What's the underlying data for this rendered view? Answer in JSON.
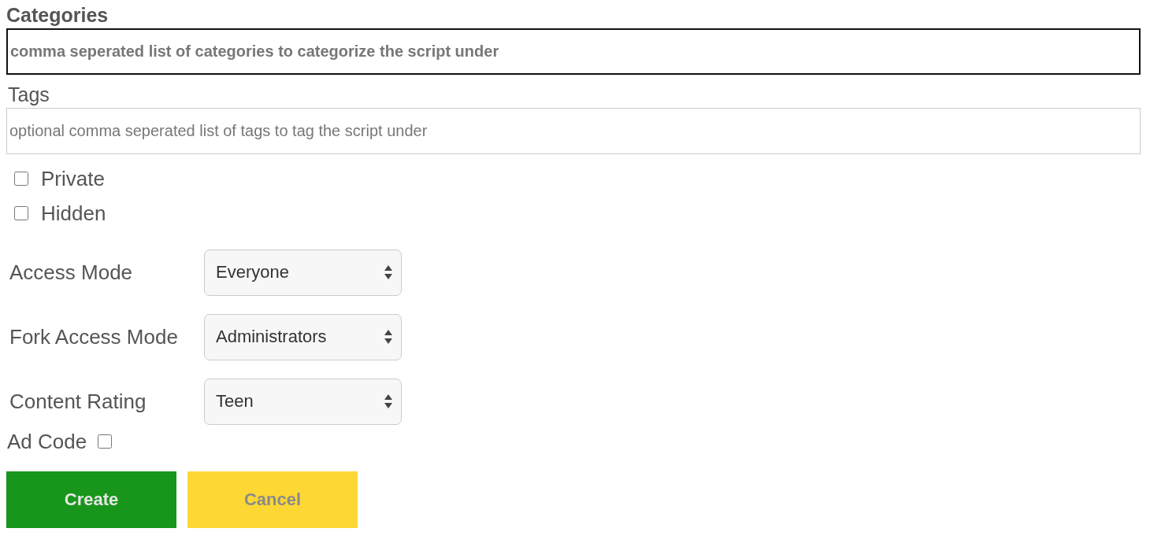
{
  "categories": {
    "label": "Categories",
    "placeholder": "comma seperated list of categories to categorize the script under",
    "focused": true
  },
  "tags": {
    "label": "Tags",
    "placeholder": "optional comma seperated list of tags to tag the script under",
    "focused": false
  },
  "checkboxes": [
    {
      "label": "Private",
      "checked": false
    },
    {
      "label": "Hidden",
      "checked": false
    }
  ],
  "selects": [
    {
      "label": "Access Mode",
      "value": "Everyone"
    },
    {
      "label": "Fork Access Mode",
      "value": "Administrators"
    },
    {
      "label": "Content Rating",
      "value": "Teen"
    }
  ],
  "ad_code": {
    "label": "Ad Code",
    "checked": false
  },
  "buttons": [
    {
      "label": "Create",
      "kind": "primary"
    },
    {
      "label": "Cancel",
      "kind": "secondary"
    }
  ]
}
